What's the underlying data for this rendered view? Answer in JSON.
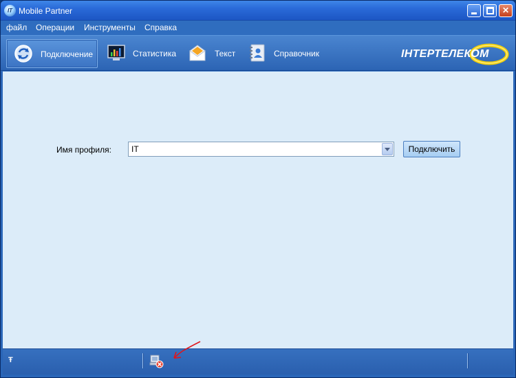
{
  "window": {
    "title": "Mobile Partner",
    "app_icon_text": "IT"
  },
  "menu": {
    "items": [
      "файл",
      "Операции",
      "Инструменты",
      "Справка"
    ]
  },
  "toolbar": {
    "tools": [
      {
        "label": "Подключение",
        "icon": "connection-icon",
        "active": true
      },
      {
        "label": "Статистика",
        "icon": "statistics-icon",
        "active": false
      },
      {
        "label": "Текст",
        "icon": "sms-envelope-icon",
        "active": false
      },
      {
        "label": "Справочник",
        "icon": "phonebook-icon",
        "active": false
      }
    ],
    "logo_text": "ІНТЕРТЕЛЕКОМ"
  },
  "main": {
    "profile_label": "Имя профиля:",
    "profile_value": "IT",
    "connect_label": "Подключить"
  },
  "status": {
    "signal_icon": "antenna-icon",
    "connection_icon": "disconnected-icon"
  },
  "colors": {
    "title_bar": "#2a6ad8",
    "toolbar": "#2c64b4",
    "content_bg": "#dcecf9",
    "annotation_arrow": "#e0161b"
  }
}
